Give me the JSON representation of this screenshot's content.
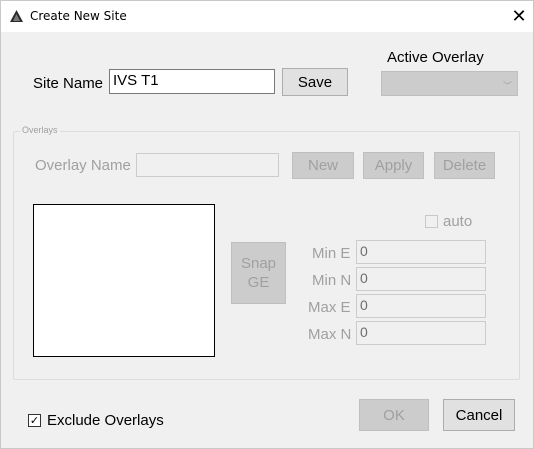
{
  "window": {
    "title": "Create New Site",
    "close_glyph": "✕"
  },
  "site": {
    "name_label": "Site Name",
    "name_value": "IVS T1",
    "save_label": "Save"
  },
  "active_overlay": {
    "label": "Active Overlay",
    "selected": ""
  },
  "overlays": {
    "group_label": "Overlays",
    "overlay_name_label": "Overlay Name",
    "overlay_name_value": "",
    "new_label": "New",
    "apply_label": "Apply",
    "delete_label": "Delete",
    "snap_label_line1": "Snap",
    "snap_label_line2": "GE",
    "auto_label": "auto",
    "auto_checked": false,
    "min_e_label": "Min E",
    "min_e_value": "0",
    "min_n_label": "Min N",
    "min_n_value": "0",
    "max_e_label": "Max E",
    "max_e_value": "0",
    "max_n_label": "Max N",
    "max_n_value": "0"
  },
  "footer": {
    "exclude_label": "Exclude Overlays",
    "exclude_checked": true,
    "check_glyph": "✓",
    "ok_label": "OK",
    "cancel_label": "Cancel"
  },
  "icons": {
    "app": "app-logo-icon",
    "close": "close-icon",
    "dropdown": "chevron-down-icon"
  }
}
